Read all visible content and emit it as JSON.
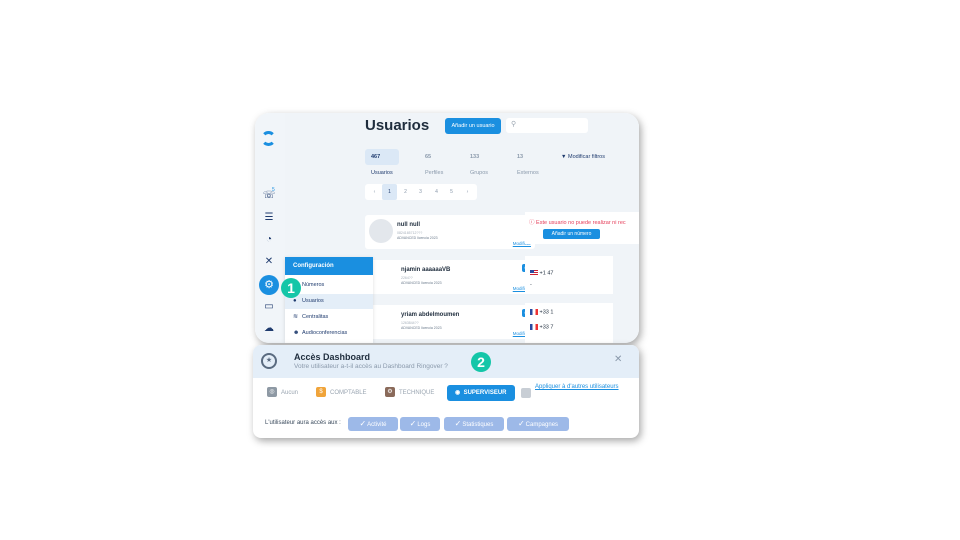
{
  "users_screen": {
    "title": "Usuarios",
    "add_user_label": "Añadir un usuario",
    "tabs": [
      {
        "count": "467",
        "label": "Usuarios"
      },
      {
        "count": "65",
        "label": "Perfiles"
      },
      {
        "count": "133",
        "label": "Grupos"
      },
      {
        "count": "13",
        "label": "Externos"
      }
    ],
    "filter_label": "Modificar filtros",
    "pagination": [
      "‹",
      "1",
      "2",
      "3",
      "4",
      "5",
      "›"
    ],
    "sidebar_badge": "5",
    "users": [
      {
        "name": "null null",
        "sub": "0824165712???",
        "license": "ADVANCED licencia 2023",
        "modify": "Modificar"
      },
      {
        "name": "njamin aaaaaaVB",
        "sub": "2264??",
        "license": "ADVANCED licencia 2023",
        "modify": "Modificar"
      },
      {
        "name": "yriam abdelmoumen",
        "sub": "1263844??",
        "license": "ADVANCED licencia 2023",
        "modify": "Modificar"
      }
    ],
    "warning_text": "Este usuario no puede realizar ni rec",
    "add_number_label": "Añadir un número",
    "phones": [
      "+1 47",
      "-",
      "+33 1",
      "+33 7"
    ],
    "config_menu": {
      "header": "Configuración",
      "items": [
        "Números",
        "Usuarios",
        "Centralitas",
        "Audioconferencias"
      ]
    }
  },
  "steps": [
    "1",
    "2"
  ],
  "dashboard_access": {
    "title": "Accès Dashboard",
    "subtitle": "Votre utilisateur a-t-il accès au Dashboard Ringover ?",
    "roles": [
      "Aucun",
      "COMPTABLE",
      "TECHNIQUE",
      "SUPERVISEUR"
    ],
    "selected_role": "SUPERVISEUR",
    "apply_link": "Appliquer à d'autres utilisateurs",
    "access_label": "L'utilisateur aura accès aux :",
    "access_chips": [
      "Activité",
      "Logs",
      "Statistiques",
      "Campagnes"
    ],
    "colors": {
      "accent": "#1a8fe0",
      "step": "#14c6a8",
      "warning": "#e53e5a",
      "chip": "#9db9e8"
    }
  }
}
